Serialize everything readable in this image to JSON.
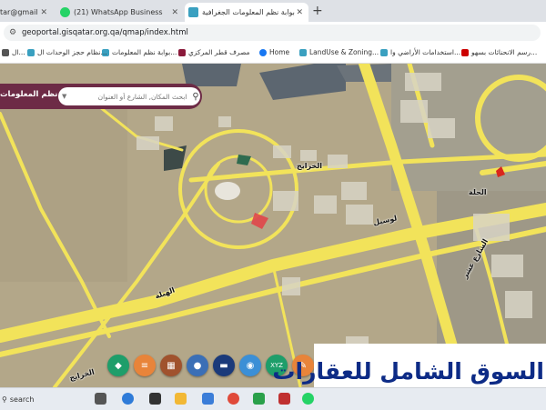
{
  "browser": {
    "tabs": [
      {
        "label": "tar@gmail",
        "active": false
      },
      {
        "label": "(21) WhatsApp Business",
        "active": false
      },
      {
        "label": "بوابة نظم المعلومات الجغرافية",
        "active": true
      }
    ],
    "new_tab_icon": "plus-icon",
    "url": "geoportal.gisqatar.org.qa/qmap/index.html"
  },
  "bookmarks": [
    {
      "label": "رسم الانحنائات بسهو...",
      "color": "#cc0000"
    },
    {
      "label": "استخدامات الأراضي وا...",
      "color": "#3aa0c0"
    },
    {
      "label": "LandUse & Zoning...",
      "color": "#3aa0c0"
    },
    {
      "label": "Home",
      "color": "#1877f2"
    },
    {
      "label": "مصرف قطر المركزي",
      "color": "#8b1a3b"
    },
    {
      "label": "بوابة نظم المعلومات...",
      "color": "#3aa0c0"
    },
    {
      "label": "نظام حجز الوحدات ال...",
      "color": "#3aa0c0"
    },
    {
      "label": "ال...",
      "color": "#555555"
    }
  ],
  "portal": {
    "title": "بوابة نظم المعلومات",
    "search_placeholder": "ابحث المكان, الشارع أو العنوان"
  },
  "map_labels": [
    {
      "label": "الخرايج"
    },
    {
      "label": "لوسيل"
    },
    {
      "label": "الحلة"
    },
    {
      "label": "الشارع عشر"
    },
    {
      "label": "الهبلة"
    },
    {
      "label": "الخرايج"
    }
  ],
  "tools": [
    {
      "icon": "layers-icon",
      "color": "#1e9e6a"
    },
    {
      "icon": "list-icon",
      "color": "#e8843a"
    },
    {
      "icon": "grid-icon",
      "color": "#a0522d"
    },
    {
      "icon": "magnify-icon",
      "color": "#3b6fb6"
    },
    {
      "icon": "monitor-icon",
      "color": "#1b3a7a"
    },
    {
      "icon": "location-icon",
      "color": "#3b8fd6"
    },
    {
      "icon": "xyz-icon",
      "color": "#1e9e6a"
    },
    {
      "icon": "tool-icon",
      "color": "#e8843a"
    }
  ],
  "banner": {
    "text": "السوق الشامل للعقارات"
  },
  "taskbar": {
    "search_label": "search"
  },
  "colors": {
    "header": "#6d2b46",
    "banner_text": "#0d2b86"
  }
}
